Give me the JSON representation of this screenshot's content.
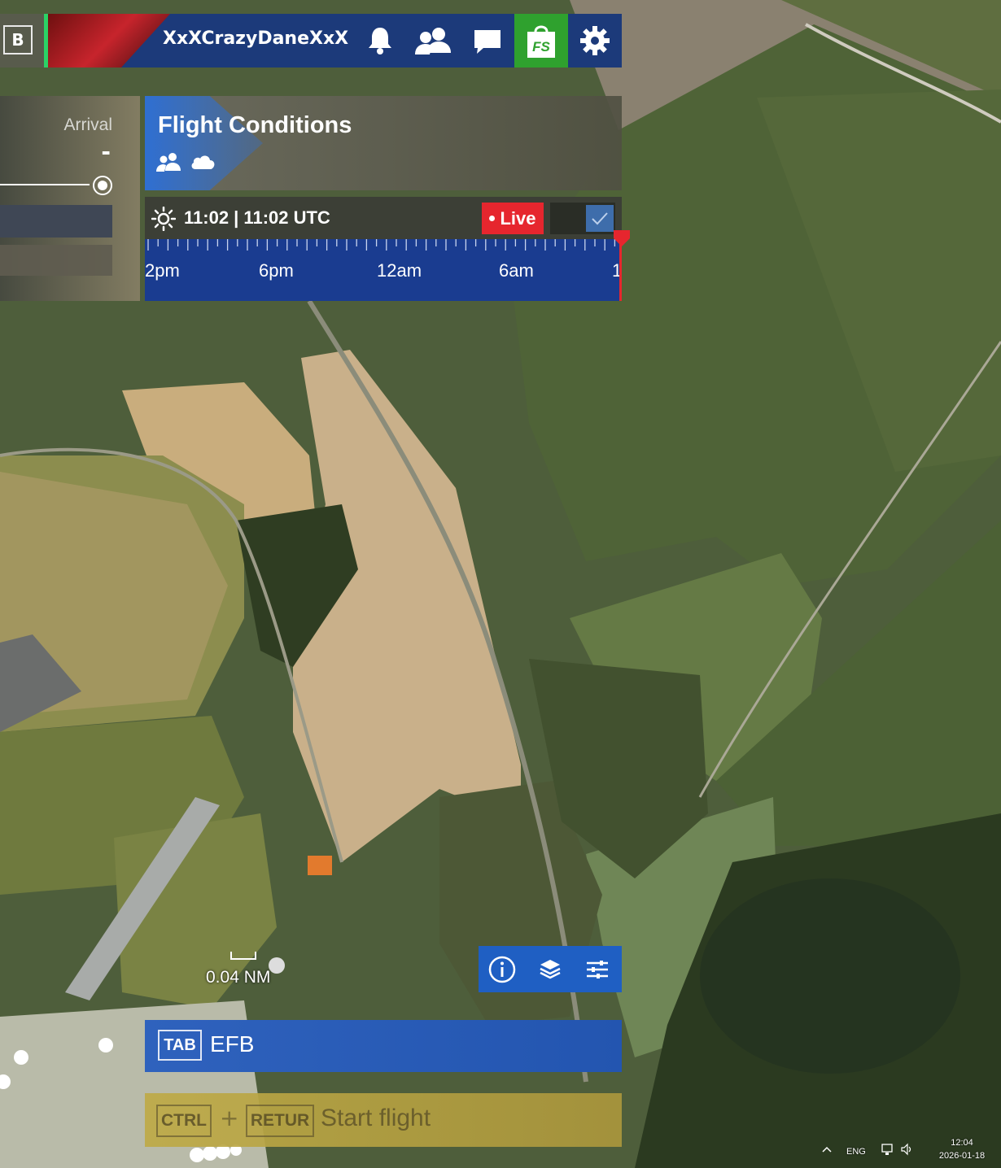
{
  "topbar": {
    "b_key": "B",
    "username": "XxXCrazyDaneXxX",
    "icons": [
      "bell-icon",
      "friends-icon",
      "chat-icon",
      "marketplace-icon",
      "gear-icon"
    ],
    "shop_label": "FS"
  },
  "side_panel": {
    "arrival_label": "Arrival",
    "arrival_value": "-"
  },
  "flight_conditions": {
    "title": "Flight Conditions",
    "time": "11:02 | 11:02 UTC",
    "live_label": "Live",
    "live_enabled": true,
    "timeline_labels": [
      "2pm",
      "6pm",
      "12am",
      "6am",
      "1"
    ]
  },
  "map": {
    "scale": "0.04 NM",
    "tools": [
      "info-icon",
      "layers-icon",
      "filters-icon"
    ]
  },
  "efb": {
    "key": "TAB",
    "label": "EFB"
  },
  "start_flight": {
    "key1": "CTRL",
    "plus": "+",
    "key2": "RETUR",
    "label": "Start flight"
  },
  "tray": {
    "lang": "ENG",
    "time": "12:04",
    "date": "2026-01-18"
  },
  "colors": {
    "brand_blue": "#1c3a7a",
    "live_red": "#e6262e",
    "shop_green": "#2fa12e",
    "efb_blue": "#2f62bd",
    "start_gold": "#bea246"
  }
}
